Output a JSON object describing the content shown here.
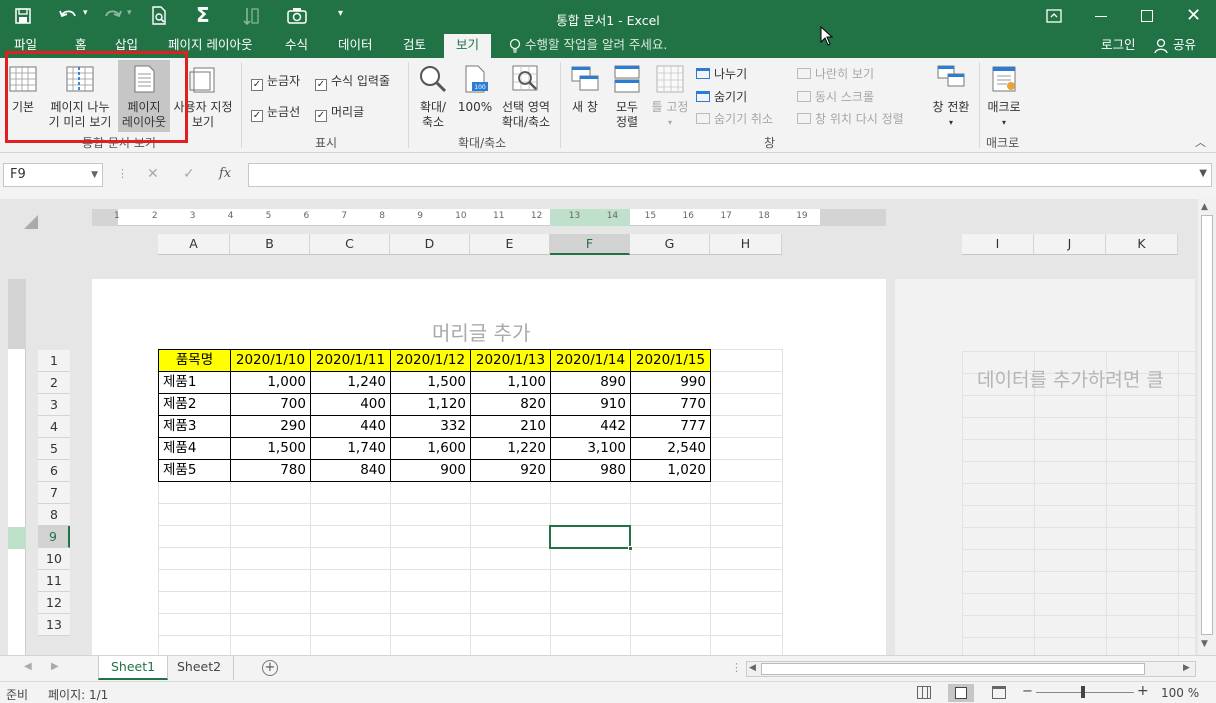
{
  "title_bar": {
    "title": "통합 문서1 - Excel"
  },
  "tabs": {
    "file": "파일",
    "home": "홈",
    "insert": "삽입",
    "page_layout": "페이지 레이아웃",
    "formulas": "수식",
    "data": "데이터",
    "review": "검토",
    "view": "보기"
  },
  "tell_me": "수행할 작업을 알려 주세요.",
  "account": {
    "login": "로그인",
    "share": "공유"
  },
  "ribbon": {
    "workbook_views": {
      "normal": "기본",
      "page_break_1": "페이지 나누",
      "page_break_2": "기 미리 보기",
      "page_layout_1": "페이지",
      "page_layout_2": "레이아웃",
      "custom_1": "사용자 지정",
      "custom_2": "보기",
      "group": "통합 문서 보기"
    },
    "show": {
      "ruler": "눈금자",
      "formula_bar": "수식 입력줄",
      "gridlines": "눈금선",
      "headings": "머리글",
      "group": "표시"
    },
    "zoom": {
      "zoom_1": "확대/",
      "zoom_2": "축소",
      "hundred": "100%",
      "sel_1": "선택 영역",
      "sel_2": "확대/축소",
      "group": "확대/축소"
    },
    "window": {
      "new_window": "새 창",
      "arrange_1": "모두",
      "arrange_2": "정렬",
      "freeze": "틀 고정",
      "split": "나누기",
      "hide": "숨기기",
      "unhide": "숨기기 취소",
      "side_by_side": "나란히 보기",
      "sync_scroll": "동시 스크롤",
      "reset_pos": "창 위치 다시 정렬",
      "switch": "창 전환",
      "group": "창"
    },
    "macros": {
      "macros": "매크로",
      "group": "매크로"
    }
  },
  "name_box": "F9",
  "formula_fx": "fx",
  "header_placeholder": "머리글 추가",
  "right_page_hint": "데이터를 추가하려면 클",
  "columns": [
    "A",
    "B",
    "C",
    "D",
    "E",
    "F",
    "G",
    "H"
  ],
  "columns_right": [
    "I",
    "J",
    "K"
  ],
  "ruler_numbers": [
    "1",
    "2",
    "3",
    "4",
    "5",
    "6",
    "7",
    "8",
    "9",
    "10",
    "11",
    "12",
    "13",
    "14",
    "15",
    "16",
    "17",
    "18",
    "19"
  ],
  "rows": [
    "1",
    "2",
    "3",
    "4",
    "5",
    "6",
    "7",
    "8",
    "9",
    "10",
    "11",
    "12",
    "13"
  ],
  "table": {
    "header": [
      "품목명",
      "2020/1/10",
      "2020/1/11",
      "2020/1/12",
      "2020/1/13",
      "2020/1/14",
      "2020/1/15"
    ],
    "rows": [
      [
        "제품1",
        "1,000",
        "1,240",
        "1,500",
        "1,100",
        "890",
        "990"
      ],
      [
        "제품2",
        "700",
        "400",
        "1,120",
        "820",
        "910",
        "770"
      ],
      [
        "제품3",
        "290",
        "440",
        "332",
        "210",
        "442",
        "777"
      ],
      [
        "제품4",
        "1,500",
        "1,740",
        "1,600",
        "1,220",
        "3,100",
        "2,540"
      ],
      [
        "제품5",
        "780",
        "840",
        "900",
        "920",
        "980",
        "1,020"
      ]
    ]
  },
  "sheets": [
    "Sheet1",
    "Sheet2"
  ],
  "status": {
    "ready": "준비",
    "page": "페이지: 1/1",
    "zoom": "100 %"
  },
  "colors": {
    "excel_green": "#217346",
    "header_yellow": "#ffff00",
    "highlight_red": "#e02020"
  }
}
